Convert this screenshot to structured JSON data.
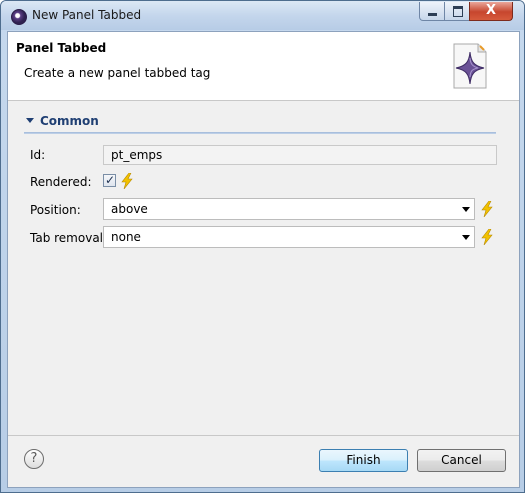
{
  "window": {
    "title": "New Panel Tabbed",
    "close_label": "X"
  },
  "header": {
    "title": "Panel Tabbed",
    "description": "Create a new panel tabbed tag"
  },
  "section": {
    "title": "Common"
  },
  "form": {
    "id": {
      "label": "Id:",
      "value": "pt_emps"
    },
    "rendered": {
      "label": "Rendered:",
      "checked": true,
      "check_glyph": "✓"
    },
    "position": {
      "label": "Position:",
      "value": "above"
    },
    "tab_removal": {
      "label": "Tab removal:",
      "value": "none"
    }
  },
  "footer": {
    "help_glyph": "?",
    "finish_label": "Finish",
    "cancel_label": "Cancel"
  },
  "colors": {
    "section_accent": "#1f3f73",
    "bolt": "#f2c200",
    "primary_button": "#bee6fd"
  },
  "icons": [
    "eclipse-icon",
    "minimize-icon",
    "maximize-icon",
    "close-icon",
    "wizard-star-icon",
    "expand-arrow-icon",
    "lightning-icon",
    "dropdown-arrow-icon",
    "help-icon"
  ]
}
